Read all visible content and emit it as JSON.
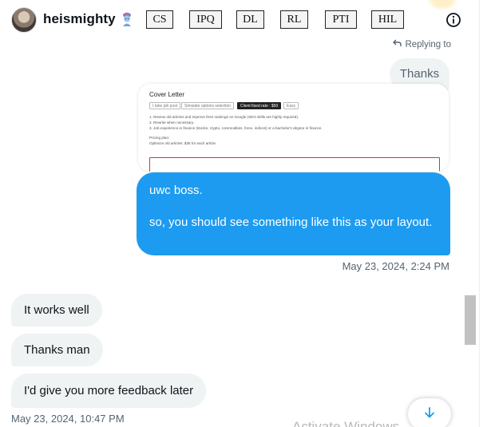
{
  "header": {
    "username": "heismighty",
    "emoji_icon": "genie-emoji-icon",
    "tags": [
      "CS",
      "IPQ",
      "DL",
      "RL",
      "PTI",
      "HIL"
    ],
    "info_icon": "info-icon"
  },
  "conversation": {
    "replying_label": "Replying to",
    "replied_message": "Thanks",
    "preview": {
      "title": "Cover Letter",
      "chips": [
        "I take job post",
        "Simulate options selection",
        "Client fixed rate : $50",
        "Easy"
      ],
      "lines": [
        "1. Review old articles and improve their rankings on Google (SEO skills are highly required).",
        "2. Rewrite when necessary.",
        "3. Job experience in finance (stocks, crypto, commodities, forex, indices) or a bachelor's degree in finance.",
        "Pricing plan:",
        "Optimize old articles: $35 for each article."
      ]
    },
    "outgoing_message": {
      "line1": "uwc boss.",
      "line2": "so, you should see something like this as your layout."
    },
    "outgoing_timestamp": "May 23, 2024, 2:24 PM",
    "incoming_messages": [
      "It works well",
      "Thanks man",
      "I'd give you more feedback later"
    ],
    "incoming_timestamp": "May 23, 2024, 10:47 PM"
  },
  "overlay": {
    "watermark": "Activate Windows",
    "scroll_down_icon": "arrow-down-icon"
  },
  "colors": {
    "accent": "#1d9bf0",
    "bubble_grey": "#eff3f4",
    "muted_text": "#536471"
  }
}
